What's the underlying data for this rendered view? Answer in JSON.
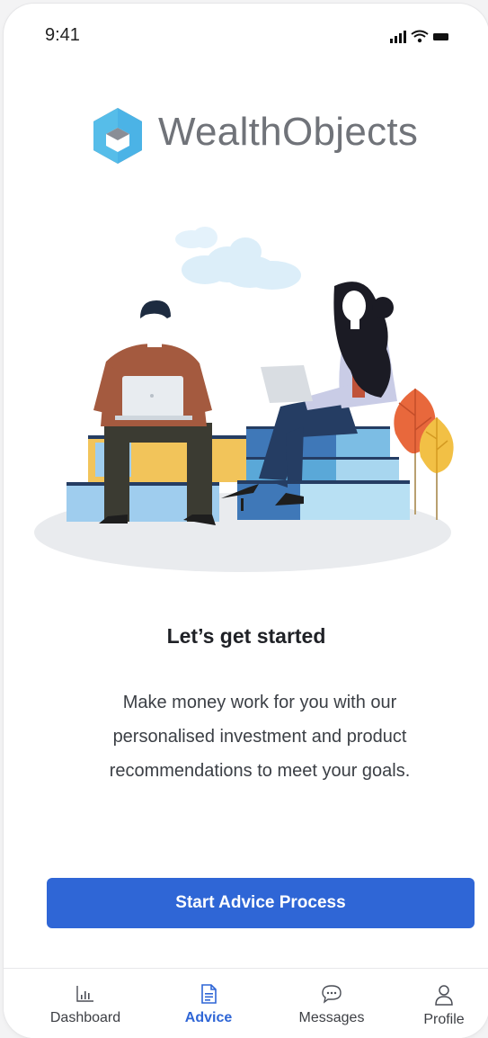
{
  "status_bar": {
    "time": "9:41",
    "icons": [
      "signal-icon",
      "wifi-icon",
      "battery-icon"
    ]
  },
  "logo": {
    "text": "WealthObjects",
    "icon": "wealthobjects-logo-icon"
  },
  "illustration": {
    "icon": "people-on-books-illustration"
  },
  "content": {
    "headline": "Let’s get started",
    "description_lines": [
      "Make money work for you with our",
      "personalised investment and product",
      "recommendations to meet your goals."
    ]
  },
  "cta": {
    "label": "Start Advice Process"
  },
  "tabs": [
    {
      "label": "Dashboard",
      "icon": "bar-chart-icon",
      "active": false
    },
    {
      "label": "Advice",
      "icon": "document-icon",
      "active": true
    },
    {
      "label": "Messages",
      "icon": "chat-bubble-icon",
      "active": false
    },
    {
      "label": "Profile",
      "icon": "person-icon",
      "active": false
    }
  ],
  "colors": {
    "accent": "#2f66d6",
    "logo_blue": "#4bb3e6",
    "logo_gray": "#8a8e96"
  }
}
